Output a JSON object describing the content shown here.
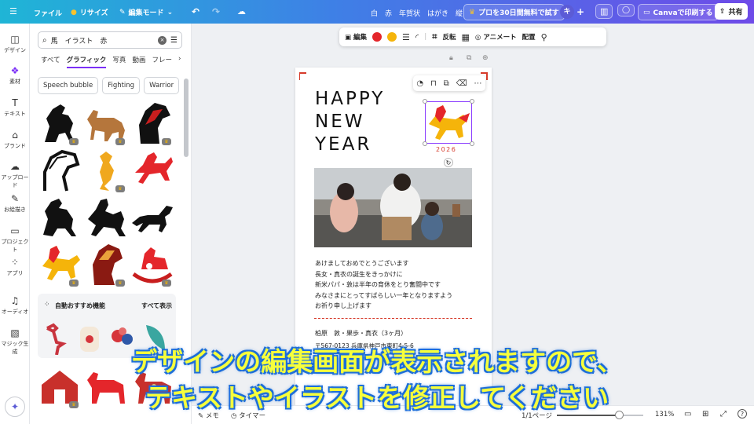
{
  "topbar": {
    "menu_icon": "hamburger-icon",
    "file_label": "ファイル",
    "resize_label": "リサイズ",
    "edit_mode_label": "編集モード",
    "doc_title": "白　赤　年賀状　はがき　縦",
    "trial_label": "プロを30日間無料で試す",
    "avatar_initial": "キ",
    "print_label": "Canvaで印刷する",
    "share_label": "共有",
    "accent": "#7b2ff7"
  },
  "rail": [
    {
      "label": "デザイン",
      "icon": "layout-icon",
      "glyph": "◫"
    },
    {
      "label": "素材",
      "icon": "elements-icon",
      "glyph": "❖"
    },
    {
      "label": "テキスト",
      "icon": "text-icon",
      "glyph": "T"
    },
    {
      "label": "ブランド",
      "icon": "brand-icon",
      "glyph": "⌂"
    },
    {
      "label": "アップロード",
      "icon": "upload-icon",
      "glyph": "☁"
    },
    {
      "label": "お絵描き",
      "icon": "draw-icon",
      "glyph": "✎"
    },
    {
      "label": "プロジェクト",
      "icon": "folder-icon",
      "glyph": "▭"
    },
    {
      "label": "アプリ",
      "icon": "apps-icon",
      "glyph": "⁘"
    },
    {
      "label": "オーディオ",
      "icon": "music-icon",
      "glyph": "♫"
    },
    {
      "label": "マジック生成",
      "icon": "magic-media-icon",
      "glyph": "▧"
    }
  ],
  "panel": {
    "search_value": "馬　イラスト　赤",
    "tabs": [
      "すべて",
      "グラフィック",
      "写真",
      "動画",
      "フレー"
    ],
    "chips": [
      "Speech bubble",
      "Fighting",
      "Warrior"
    ],
    "recommend_title": "自動おすすめ機能",
    "recommend_all": "すべて表示"
  },
  "ctxbar": {
    "edit_label": "編集",
    "colors": [
      "#e4262b",
      "#f5b40a"
    ],
    "flip_label": "反転",
    "animate_label": "アニメート",
    "position_label": "配置"
  },
  "card": {
    "headline": [
      "HAPPY",
      "NEW",
      "YEAR"
    ],
    "year": "2026",
    "message": [
      "あけましておめでとうございます",
      "長女・真衣の誕生をきっかけに",
      "新米パパ・敦は半年の育休をとり奮闘中です",
      "みなさまにとってすばらしい一年となりますよう",
      "お祈り申し上げます"
    ],
    "sender": "柏原　敦・果歩・真衣（3ヶ月）",
    "address": "〒567-0123 兵庫県神戸市東町4-5-6"
  },
  "subtitle": {
    "line1": "デザインの編集画面が表示されますので、",
    "line2": "テキストやイラストを修正してください"
  },
  "bottombar": {
    "memo_label": "メモ",
    "timer_label": "タイマー",
    "page_label": "1/1ページ",
    "zoom_label": "131%",
    "zoom_level": 0.72
  }
}
